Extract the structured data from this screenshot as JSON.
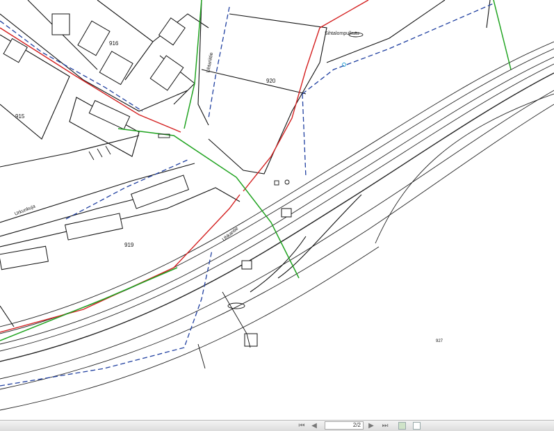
{
  "map": {
    "parcels": [
      "916",
      "920",
      "915",
      "919",
      "927"
    ],
    "place_name": "Sihtalompulkutu",
    "streets": [
      "Sihtalompolku",
      "Lihtariiitie",
      "Urkunkuja",
      "Uhkantie"
    ],
    "colors": {
      "background": "#ffffff",
      "linework": "#1a1a1a",
      "red_line": "#d42020",
      "green_line": "#1fa31f",
      "blue_dashed": "#1f3fa0"
    }
  },
  "viewer_toolbar": {
    "page_indicator": "2/2",
    "icons": [
      "first-page-icon",
      "previous-page-icon",
      "next-page-icon",
      "last-page-icon",
      "thumbnail-icon",
      "document-icon"
    ]
  }
}
